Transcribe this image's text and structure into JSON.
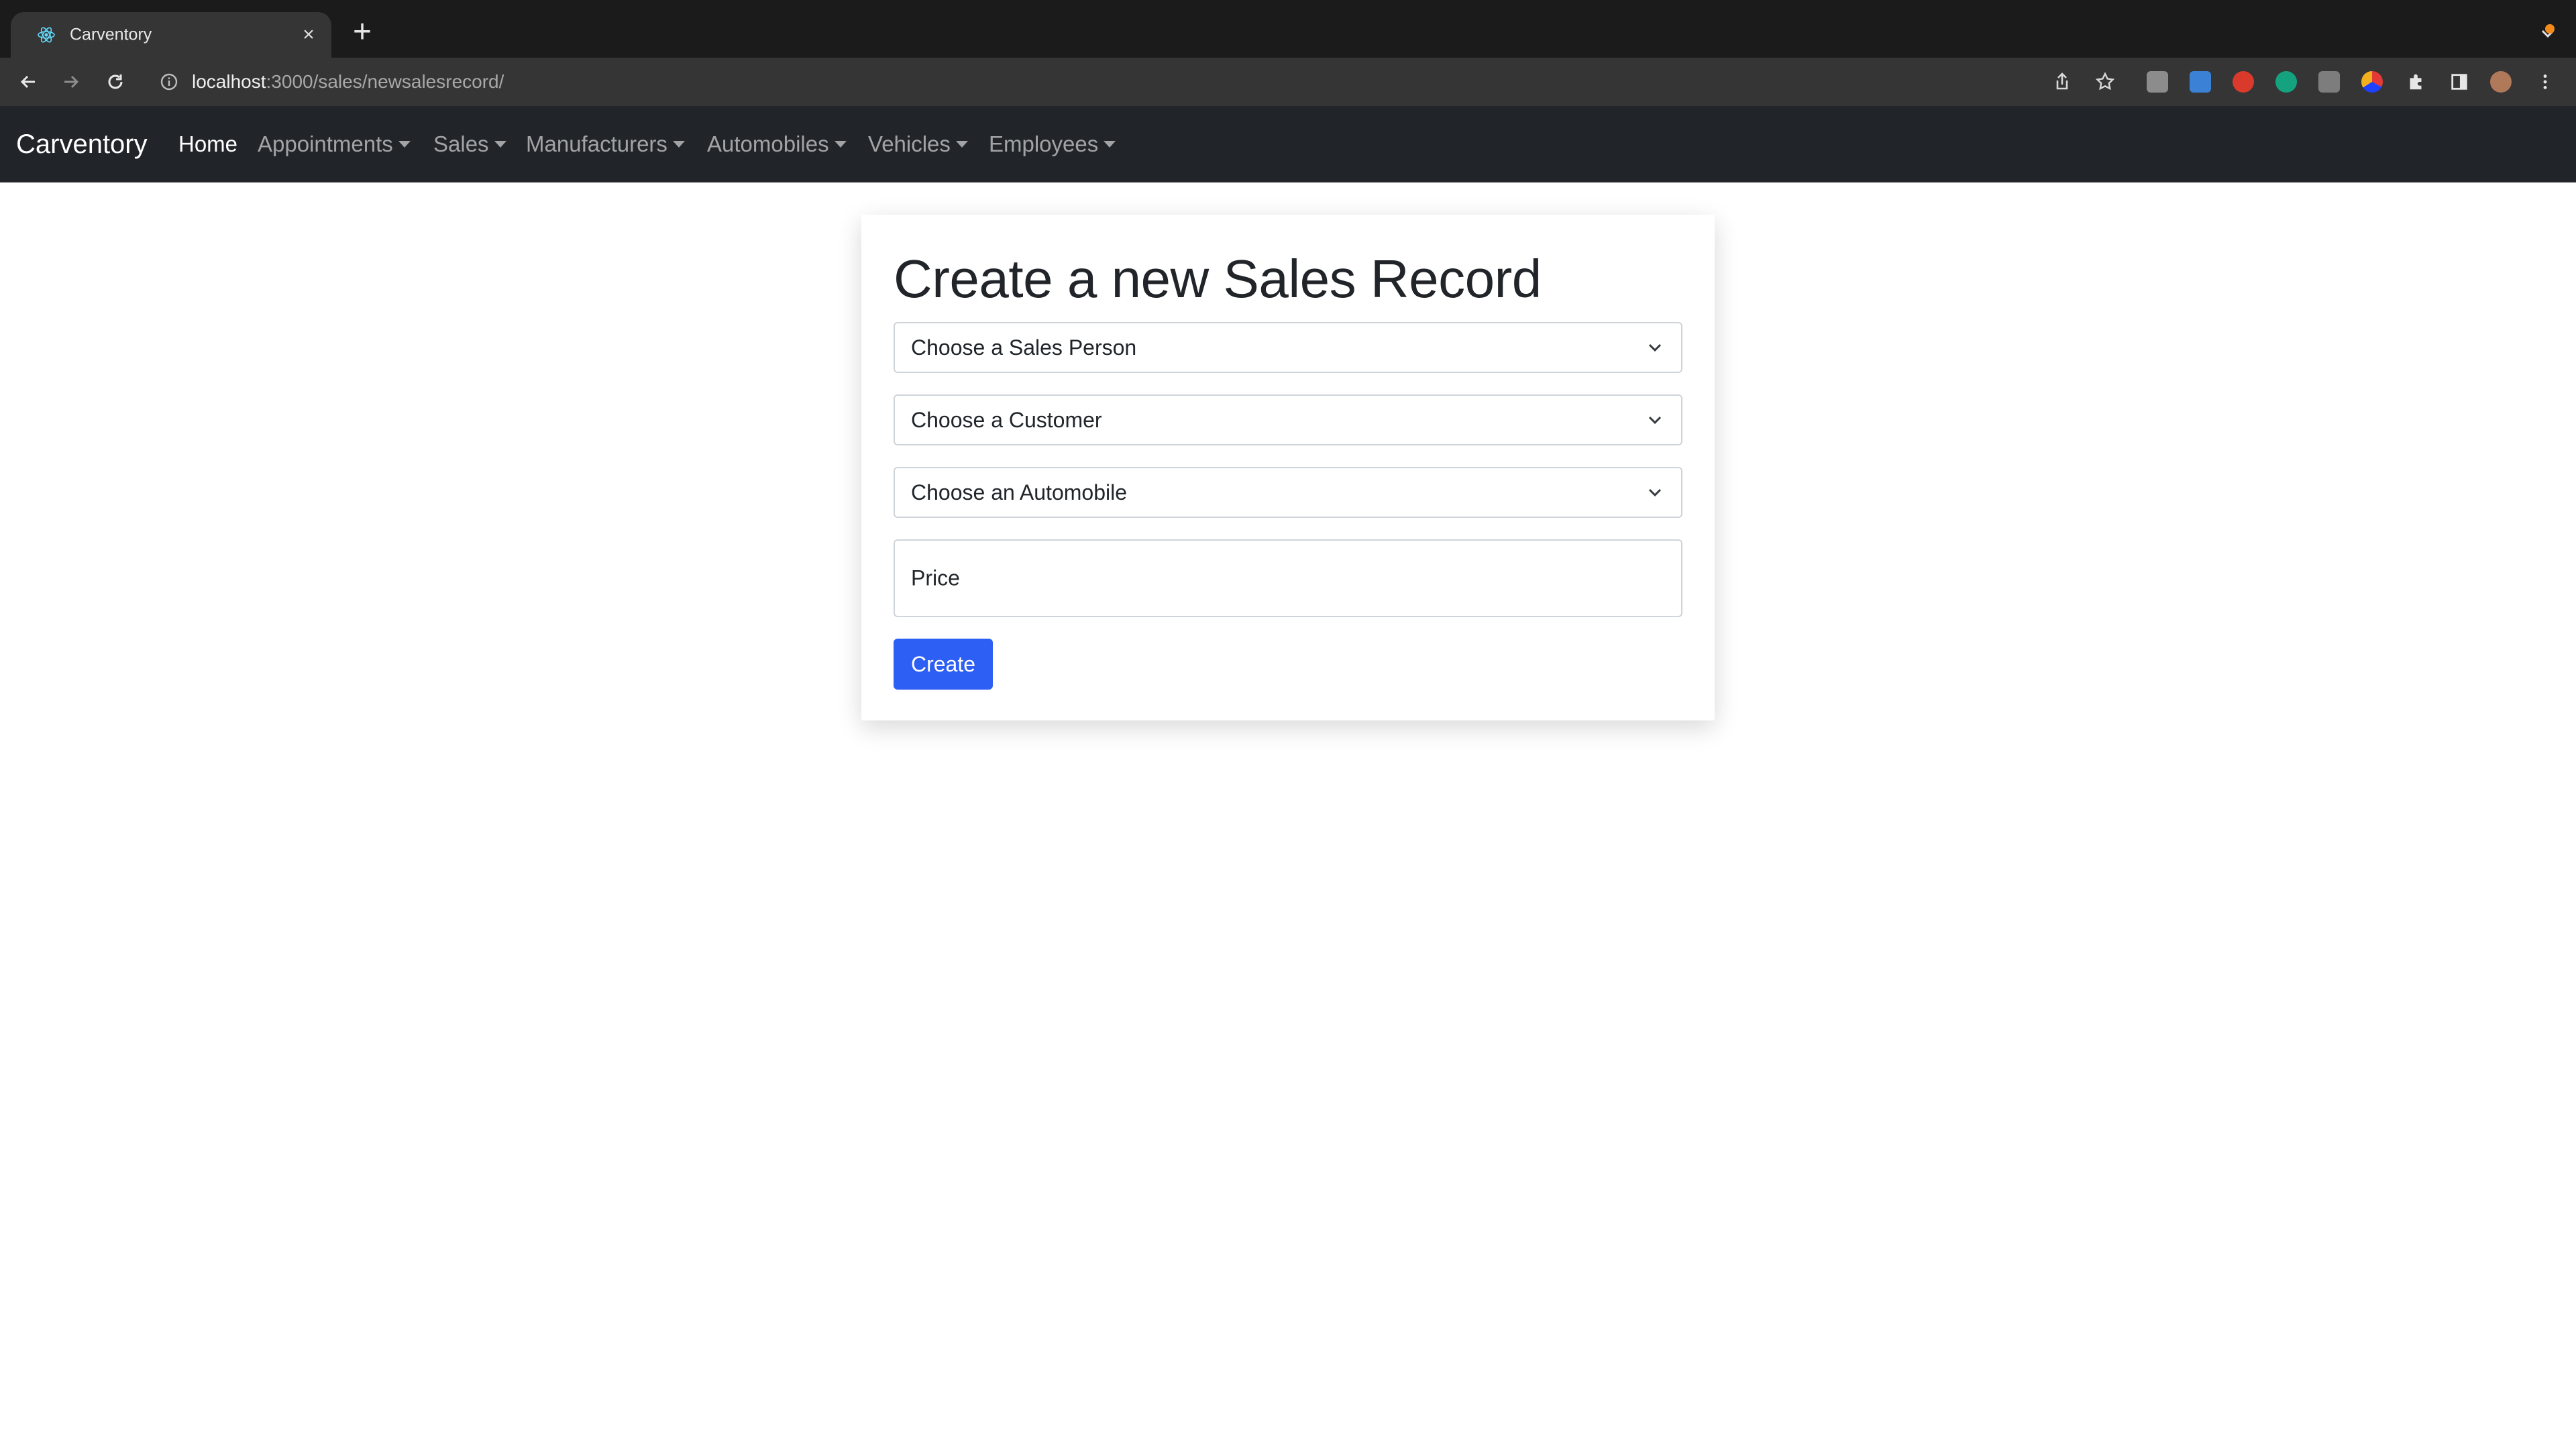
{
  "browser": {
    "tab_title": "Carventory",
    "tab_close_glyph": "×",
    "new_tab_glyph": "+",
    "url_host": "localhost",
    "url_path": ":3000/sales/newsalesrecord/",
    "icons": [
      "back-icon",
      "forward-icon",
      "reload-icon",
      "site-info-icon",
      "share-icon",
      "bookmark-star-icon",
      "extensions-puzzle-icon",
      "side-panel-icon",
      "profile-avatar",
      "menu-kebab-icon"
    ]
  },
  "navbar": {
    "brand": "Carventory",
    "items": [
      {
        "label": "Home",
        "active": true,
        "dropdown": false
      },
      {
        "label": "Appointments",
        "active": false,
        "dropdown": true
      },
      {
        "label": "Sales",
        "active": false,
        "dropdown": true
      },
      {
        "label": "Manufacturers",
        "active": false,
        "dropdown": true
      },
      {
        "label": "Automobiles",
        "active": false,
        "dropdown": true
      },
      {
        "label": "Vehicles",
        "active": false,
        "dropdown": true
      },
      {
        "label": "Employees",
        "active": false,
        "dropdown": true
      }
    ]
  },
  "form": {
    "title": "Create a new Sales Record",
    "sales_person_select": "Choose a Sales Person",
    "customer_select": "Choose a Customer",
    "automobile_select": "Choose an Automobile",
    "price_label": "Price",
    "submit_label": "Create"
  },
  "colors": {
    "navbar_bg": "#212529",
    "primary_button": "#2e5ff5",
    "browser_chrome": "#353535"
  }
}
